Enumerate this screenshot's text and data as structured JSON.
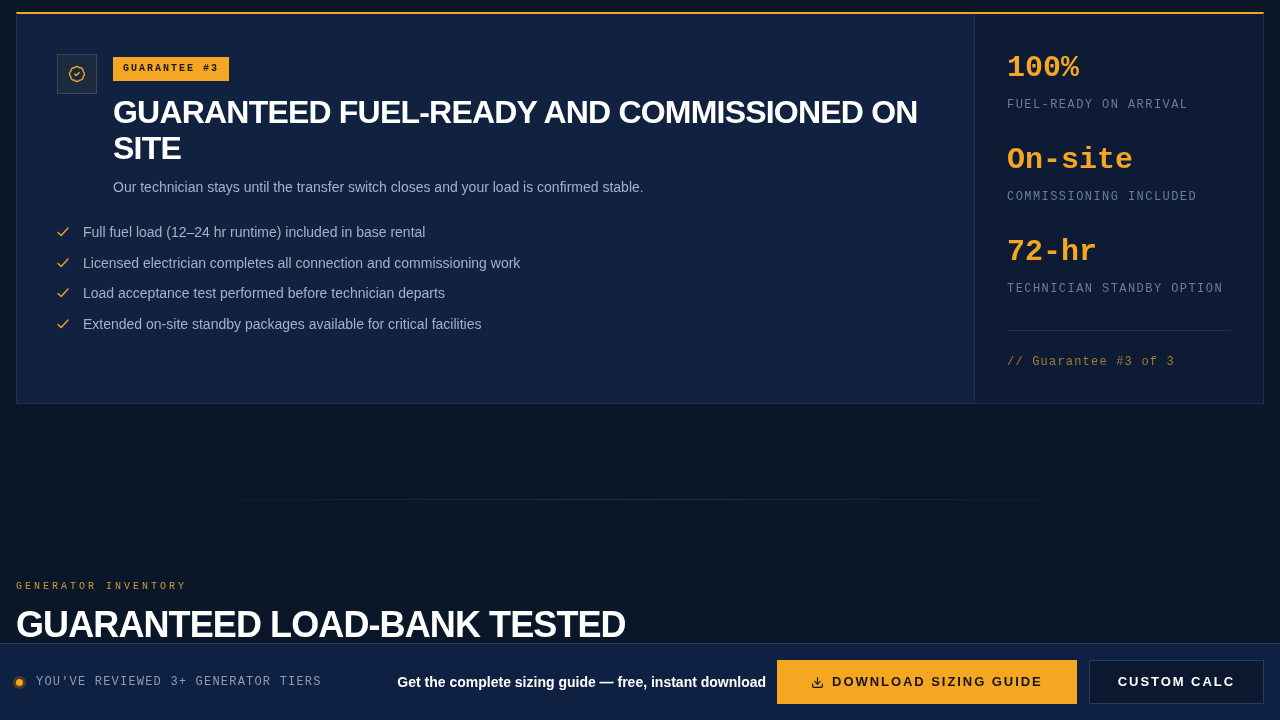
{
  "guarantee": {
    "badge": "GUARANTEE #3",
    "title": "GUARANTEED FUEL-READY AND COMMISSIONED ON SITE",
    "subtitle": "Our technician stays until the transfer switch closes and your load is confirmed stable.",
    "features": [
      "Full fuel load (12–24 hr runtime) included in base rental",
      "Licensed electrician completes all connection and commissioning work",
      "Load acceptance test performed before technician departs",
      "Extended on-site standby packages available for critical facilities"
    ],
    "stats": [
      {
        "value": "100%",
        "label": "FUEL-READY ON ARRIVAL"
      },
      {
        "value": "On-site",
        "label": "COMMISSIONING INCLUDED"
      },
      {
        "value": "72-hr",
        "label": "TECHNICIAN STANDBY OPTION"
      }
    ],
    "footer": "// Guarantee #3 of 3"
  },
  "section": {
    "eyebrow": "GENERATOR INVENTORY",
    "title": "GUARANTEED LOAD-BANK TESTED"
  },
  "bottom_bar": {
    "status": "YOU'VE REVIEWED 3+ GENERATOR TIERS",
    "prompt": "Get the complete sizing guide — free, instant download",
    "buttons": [
      {
        "label": "DOWNLOAD SIZING GUIDE",
        "kind": "primary"
      },
      {
        "label": "CUSTOM CALC",
        "kind": "secondary"
      }
    ]
  }
}
